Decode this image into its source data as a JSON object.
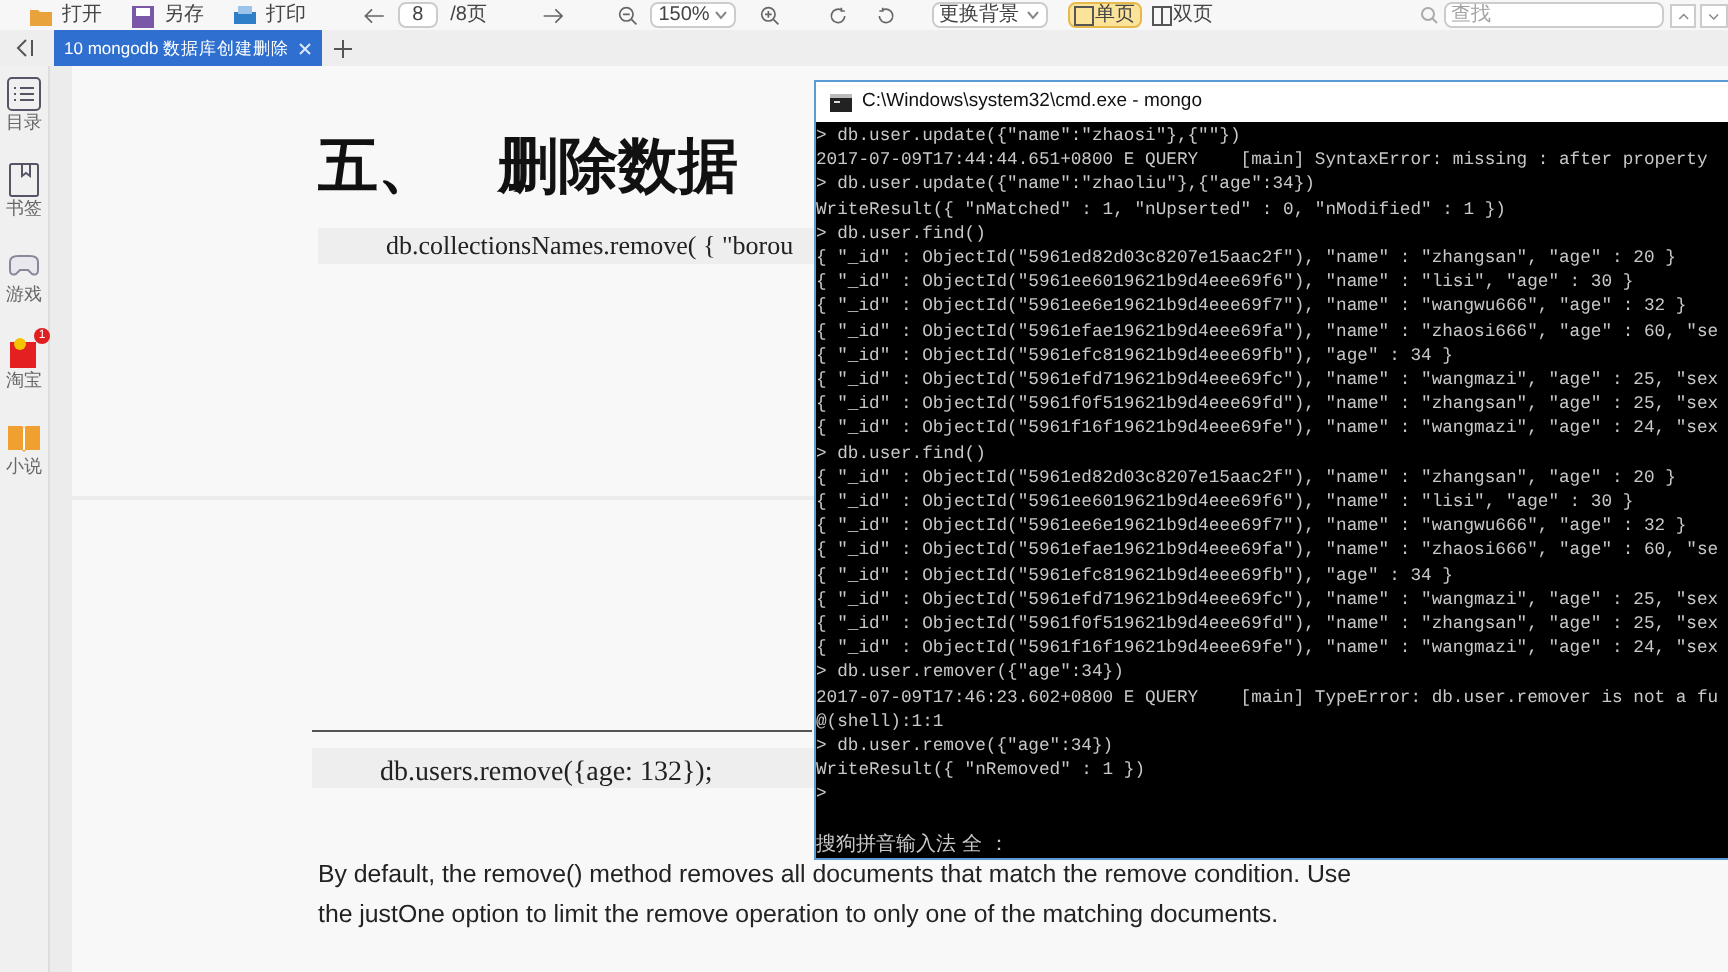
{
  "toolbar": {
    "buttons": [
      {
        "kind": "open",
        "label": "打开"
      },
      {
        "kind": "save",
        "label": "另存"
      },
      {
        "kind": "print",
        "label": "打印"
      }
    ],
    "page_input": "8",
    "page_total": "/8页",
    "zoom": "150%",
    "background_dropdown": "更换背景",
    "view_modes": [
      {
        "kind": "single",
        "label": "单页",
        "selected": true
      },
      {
        "kind": "double",
        "label": "双页",
        "selected": false
      }
    ],
    "search": {
      "placeholder": "查找"
    }
  },
  "tabs": [
    {
      "label": "10 mongodb 数据库创建删除",
      "selected": true
    }
  ],
  "sidebar": {
    "items": [
      {
        "kind": "toc",
        "label": "目录"
      },
      {
        "kind": "bookmark",
        "label": "书签"
      },
      {
        "kind": "game",
        "label": "游戏"
      },
      {
        "kind": "shop",
        "label": "淘宝",
        "badge": "1"
      },
      {
        "kind": "novel",
        "label": "小说"
      }
    ]
  },
  "document": {
    "heading_number": "五、",
    "heading": "删除数据",
    "code_1": "db.collectionsNames.remove( { \"borou",
    "code_2": "db.users.remove({age: 132});",
    "paragraph": [
      "By default, the remove() method removes all documents that match the remove condition. Use",
      "the justOne option to limit the remove operation to only one of the matching documents."
    ]
  },
  "console": {
    "title": "C:\\Windows\\system32\\cmd.exe - mongo",
    "lines": [
      "> db.user.update({\"name\":\"zhaosi\"},{\"\"})",
      "2017-07-09T17:44:44.651+0800 E QUERY    [main] SyntaxError: missing : after property",
      "> db.user.update({\"name\":\"zhaoliu\"},{\"age\":34})",
      "WriteResult({ \"nMatched\" : 1, \"nUpserted\" : 0, \"nModified\" : 1 })",
      "> db.user.find()",
      "{ \"_id\" : ObjectId(\"5961ed82d03c8207e15aac2f\"), \"name\" : \"zhangsan\", \"age\" : 20 }",
      "{ \"_id\" : ObjectId(\"5961ee6019621b9d4eee69f6\"), \"name\" : \"lisi\", \"age\" : 30 }",
      "{ \"_id\" : ObjectId(\"5961ee6e19621b9d4eee69f7\"), \"name\" : \"wangwu666\", \"age\" : 32 }",
      "{ \"_id\" : ObjectId(\"5961efae19621b9d4eee69fa\"), \"name\" : \"zhaosi666\", \"age\" : 60, \"se",
      "{ \"_id\" : ObjectId(\"5961efc819621b9d4eee69fb\"), \"age\" : 34 }",
      "{ \"_id\" : ObjectId(\"5961efd719621b9d4eee69fc\"), \"name\" : \"wangmazi\", \"age\" : 25, \"sex",
      "{ \"_id\" : ObjectId(\"5961f0f519621b9d4eee69fd\"), \"name\" : \"zhangsan\", \"age\" : 25, \"sex",
      "{ \"_id\" : ObjectId(\"5961f16f19621b9d4eee69fe\"), \"name\" : \"wangmazi\", \"age\" : 24, \"sex",
      "> db.user.find()",
      "{ \"_id\" : ObjectId(\"5961ed82d03c8207e15aac2f\"), \"name\" : \"zhangsan\", \"age\" : 20 }",
      "{ \"_id\" : ObjectId(\"5961ee6019621b9d4eee69f6\"), \"name\" : \"lisi\", \"age\" : 30 }",
      "{ \"_id\" : ObjectId(\"5961ee6e19621b9d4eee69f7\"), \"name\" : \"wangwu666\", \"age\" : 32 }",
      "{ \"_id\" : ObjectId(\"5961efae19621b9d4eee69fa\"), \"name\" : \"zhaosi666\", \"age\" : 60, \"se",
      "{ \"_id\" : ObjectId(\"5961efc819621b9d4eee69fb\"), \"age\" : 34 }",
      "{ \"_id\" : ObjectId(\"5961efd719621b9d4eee69fc\"), \"name\" : \"wangmazi\", \"age\" : 25, \"sex",
      "{ \"_id\" : ObjectId(\"5961f0f519621b9d4eee69fd\"), \"name\" : \"zhangsan\", \"age\" : 25, \"sex",
      "{ \"_id\" : ObjectId(\"5961f16f19621b9d4eee69fe\"), \"name\" : \"wangmazi\", \"age\" : 24, \"sex",
      "> db.user.remover({\"age\":34})",
      "2017-07-09T17:46:23.602+0800 E QUERY    [main] TypeError: db.user.remover is not a fu",
      "@(shell):1:1",
      "> db.user.remove({\"age\":34})",
      "WriteResult({ \"nRemoved\" : 1 })",
      ">"
    ],
    "ime_status": "搜狗拼音输入法 全 ："
  }
}
